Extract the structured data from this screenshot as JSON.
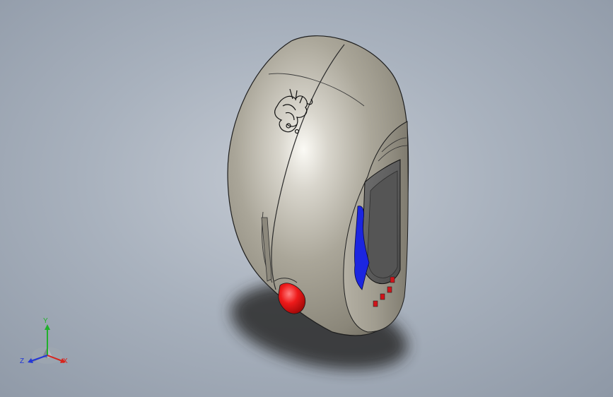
{
  "window": {
    "title": ""
  },
  "model_viewport": {
    "background_top": "#c4cad3",
    "background_bottom": "#8e98a6",
    "model": {
      "shell_color": "#a6a195",
      "button_red": "#e8141a",
      "slider_blue": "#1b25e0",
      "screen_color": "#5f5f5f",
      "emblem": "dragon-emblem"
    }
  },
  "triad": {
    "x_label": "X",
    "y_label": "Y",
    "z_label": "Z",
    "x_color": "#d8241c",
    "y_color": "#21b02b",
    "z_color": "#2336d8"
  }
}
